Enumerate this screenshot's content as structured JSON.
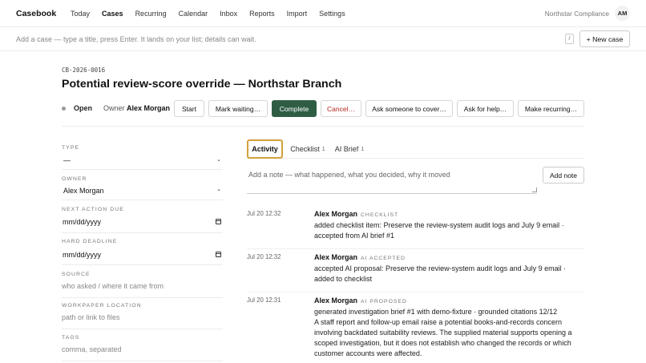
{
  "app": {
    "brand": "Casebook",
    "org": "Northstar Compliance",
    "avatar": "AM"
  },
  "nav": {
    "items": [
      "Today",
      "Cases",
      "Recurring",
      "Calendar",
      "Inbox",
      "Reports",
      "Import",
      "Settings"
    ],
    "active": "Cases"
  },
  "quickadd": {
    "placeholder": "Add a case — type a title, press Enter. It lands on your list; details can wait.",
    "shortcut": "/",
    "new_case": "+ New case"
  },
  "case": {
    "id": "CB-2026-0016",
    "title": "Potential review-score override — Northstar Branch",
    "status": "Open",
    "owner_label": "Owner",
    "owner_name": "Alex Morgan"
  },
  "actions": [
    "Start",
    "Mark waiting…",
    "Complete",
    "Cancel…",
    "Ask someone to cover…",
    "Ask for help…",
    "Make recurring…"
  ],
  "fields": {
    "type": {
      "label": "Type",
      "value": "—"
    },
    "owner": {
      "label": "Owner",
      "value": "Alex Morgan"
    },
    "next_action_due": {
      "label": "Next action due",
      "value": "mm/dd/yyyy"
    },
    "hard_deadline": {
      "label": "Hard deadline",
      "value": "mm/dd/yyyy"
    },
    "source": {
      "label": "Source",
      "placeholder": "who asked / where it came from"
    },
    "workpaper": {
      "label": "Workpaper location",
      "placeholder": "path or link to files"
    },
    "tags": {
      "label": "Tags",
      "placeholder": "comma, separated"
    }
  },
  "tabs": [
    {
      "label": "Activity",
      "count": ""
    },
    {
      "label": "Checklist",
      "count": "1"
    },
    {
      "label": "AI Brief",
      "count": "1"
    }
  ],
  "note": {
    "placeholder": "Add a note — what happened, what you decided, why it moved",
    "button": "Add note"
  },
  "activity": [
    {
      "time": "Jul 20 12:32",
      "author": "Alex Morgan",
      "tag": "Checklist",
      "line1": "added checklist item: Preserve the review-system audit logs and July 9 email ·",
      "line2": "accepted from AI brief #1"
    },
    {
      "time": "Jul 20 12:32",
      "author": "Alex Morgan",
      "tag": "AI Accepted",
      "line1": "accepted AI proposal: Preserve the review-system audit logs and July 9 email · added",
      "line2": "to checklist"
    },
    {
      "time": "Jul 20 12:31",
      "author": "Alex Morgan",
      "tag": "AI Proposed",
      "line1": "generated investigation brief #1 with demo-fixture · grounded citations 12/12",
      "line2": "A staff report and follow-up email raise a potential books-and-records concern involving backdated suitability reviews. The supplied material supports opening a scoped investigation, but it does not establish who changed the records or which customer accounts were affected."
    }
  ]
}
